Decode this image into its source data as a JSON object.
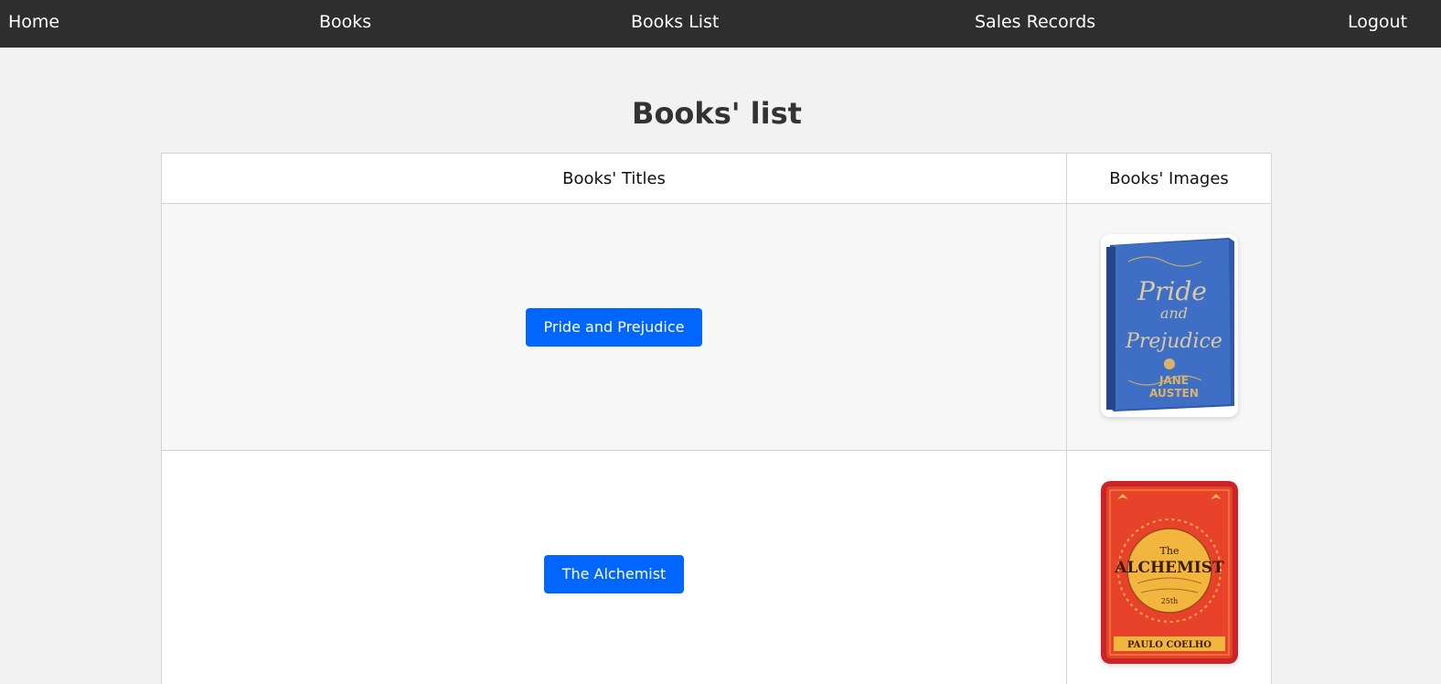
{
  "nav": {
    "home": "Home",
    "books": "Books",
    "books_list": "Books List",
    "sales_records": "Sales Records",
    "logout": "Logout"
  },
  "page": {
    "title": "Books' list"
  },
  "table": {
    "headers": {
      "titles": "Books' Titles",
      "images": "Books' Images"
    },
    "rows": [
      {
        "title": "Pride and Prejudice",
        "cover": {
          "icon": "book-cover-pride-and-prejudice",
          "color": "#3f6fc4",
          "text_line1": "Pride",
          "text_line2": "and",
          "text_line3": "Prejudice",
          "author_line1": "JANE",
          "author_line2": "AUSTEN"
        }
      },
      {
        "title": "The Alchemist",
        "cover": {
          "icon": "book-cover-the-alchemist",
          "color": "#e8432a",
          "text_line1": "The",
          "text_line2": "ALCHEMIST",
          "badge": "25th",
          "author": "PAULO COELHO"
        }
      }
    ]
  },
  "colors": {
    "navbar": "#2e2e2e",
    "button": "#0066ff",
    "background": "#f2f2f2"
  }
}
